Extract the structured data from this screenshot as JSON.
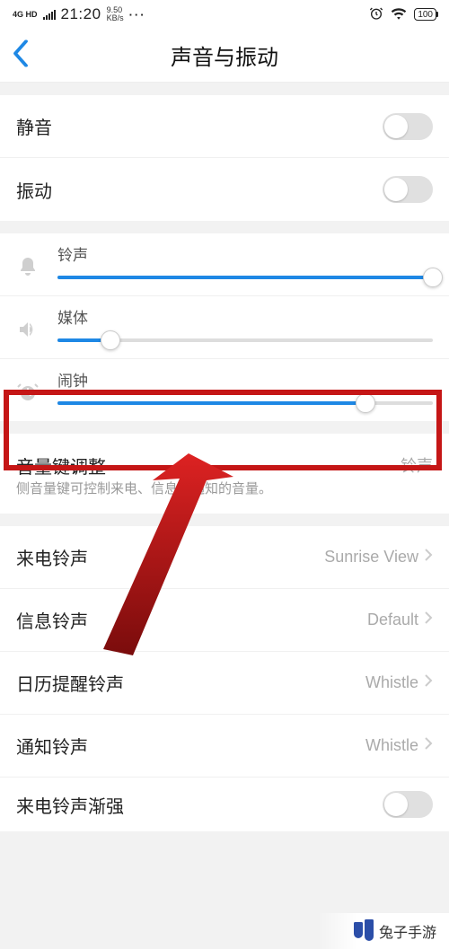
{
  "status": {
    "network": "4G HD",
    "time": "21:20",
    "speed_value": "9.50",
    "speed_unit": "KB/s",
    "dots": "···",
    "battery": "100"
  },
  "nav": {
    "title": "声音与振动"
  },
  "toggles": {
    "mute_label": "静音",
    "vibrate_label": "振动"
  },
  "sliders": {
    "ringtone": {
      "label": "铃声",
      "percent": 100
    },
    "media": {
      "label": "媒体",
      "percent": 14
    },
    "alarm": {
      "label": "闹钟",
      "percent": 82
    }
  },
  "volume_key": {
    "label": "音量键调整",
    "value": "铃声",
    "desc": "侧音量键可控制来电、信息和通知的音量。"
  },
  "ringtones": {
    "incoming": {
      "label": "来电铃声",
      "value": "Sunrise View"
    },
    "message": {
      "label": "信息铃声",
      "value": "Default"
    },
    "calendar": {
      "label": "日历提醒铃声",
      "value": "Whistle"
    },
    "notify": {
      "label": "通知铃声",
      "value": "Whistle"
    },
    "ascending": {
      "label": "来电铃声渐强"
    }
  },
  "footer": {
    "text": "兔子手游"
  }
}
